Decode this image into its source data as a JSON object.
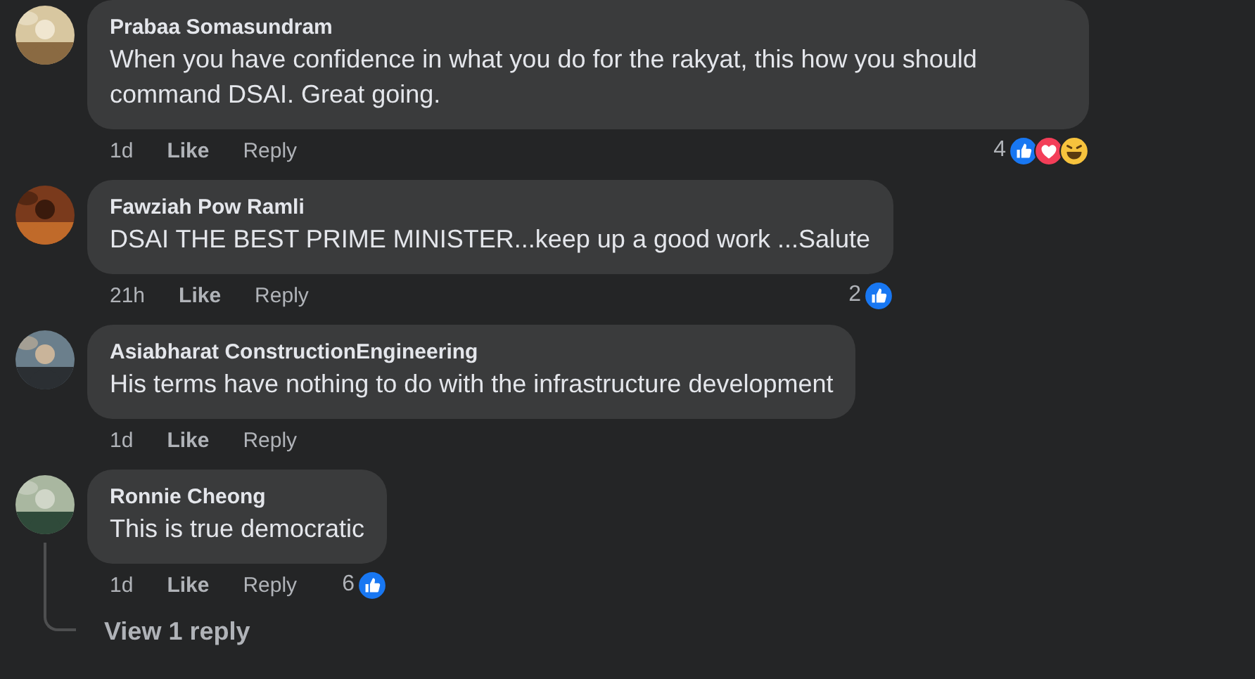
{
  "comments": [
    {
      "author": "Prabaa Somasundram",
      "text": "When you have confidence in what you do for the rakyat, this how you should command DSAI. Great going.",
      "time": "1d",
      "like": "Like",
      "reply": "Reply",
      "reactions": {
        "count": "4",
        "types": [
          {
            "kind": "like"
          },
          {
            "kind": "love"
          },
          {
            "kind": "haha"
          }
        ]
      }
    },
    {
      "author": "Fawziah Pow Ramli",
      "text": "DSAI THE BEST PRIME MINISTER...keep up a good work ...Salute",
      "time": "21h",
      "like": "Like",
      "reply": "Reply",
      "reactions": {
        "count": "2",
        "types": [
          {
            "kind": "like"
          }
        ]
      }
    },
    {
      "author": "Asiabharat ConstructionEngineering",
      "text": "His terms have nothing to do with the infrastructure development",
      "time": "1d",
      "like": "Like",
      "reply": "Reply"
    },
    {
      "author": "Ronnie Cheong",
      "text": "This is true democratic",
      "time": "1d",
      "like": "Like",
      "reply": "Reply",
      "reactions": {
        "count": "6",
        "types": [
          {
            "kind": "like"
          }
        ]
      },
      "replies_link": "View 1 reply"
    }
  ]
}
